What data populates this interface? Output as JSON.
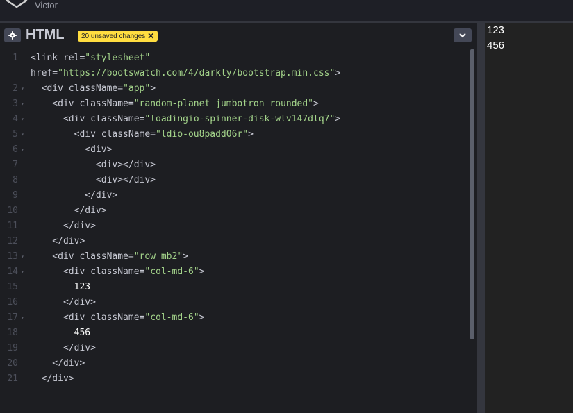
{
  "topbar": {
    "user_name": "Victor"
  },
  "editor": {
    "title": "HTML",
    "unsaved_badge": "20 unsaved changes",
    "close_symbol": "✕",
    "lines": [
      {
        "num": "1",
        "fold": "",
        "content": "<link rel=\"stylesheet\""
      },
      {
        "num": "",
        "fold": "",
        "content": "href=\"https://bootswatch.com/4/darkly/bootstrap.min.css\">"
      },
      {
        "num": "2",
        "fold": "▾",
        "content": "  <div className=\"app\">"
      },
      {
        "num": "3",
        "fold": "▾",
        "content": "    <div className=\"random-planet jumbotron rounded\">"
      },
      {
        "num": "4",
        "fold": "▾",
        "content": "      <div className=\"loadingio-spinner-disk-wlv147dlq7\">"
      },
      {
        "num": "5",
        "fold": "▾",
        "content": "        <div className=\"ldio-ou8padd06r\">"
      },
      {
        "num": "6",
        "fold": "▾",
        "content": "          <div>"
      },
      {
        "num": "7",
        "fold": "",
        "content": "            <div></div>"
      },
      {
        "num": "8",
        "fold": "",
        "content": "            <div></div>"
      },
      {
        "num": "9",
        "fold": "",
        "content": "          </div>"
      },
      {
        "num": "10",
        "fold": "",
        "content": "        </div>"
      },
      {
        "num": "11",
        "fold": "",
        "content": "      </div>"
      },
      {
        "num": "12",
        "fold": "",
        "content": "    </div>"
      },
      {
        "num": "13",
        "fold": "▾",
        "content": "    <div className=\"row mb2\">"
      },
      {
        "num": "14",
        "fold": "▾",
        "content": "      <div className=\"col-md-6\">"
      },
      {
        "num": "15",
        "fold": "",
        "content": "        123"
      },
      {
        "num": "16",
        "fold": "",
        "content": "      </div>"
      },
      {
        "num": "17",
        "fold": "▾",
        "content": "      <div className=\"col-md-6\">"
      },
      {
        "num": "18",
        "fold": "",
        "content": "        456"
      },
      {
        "num": "19",
        "fold": "",
        "content": "      </div>"
      },
      {
        "num": "20",
        "fold": "",
        "content": "    </div>"
      },
      {
        "num": "21",
        "fold": "",
        "content": "  </div>"
      }
    ]
  },
  "preview": {
    "values": [
      "123",
      "456"
    ]
  },
  "colors": {
    "accent_badge": "#ffdd40",
    "string": "#a3d38a",
    "background": "#1d1e22"
  },
  "icons": {
    "settings": "gear-icon",
    "collapse": "chevron-down-icon",
    "logo": "codepen-logo-icon"
  }
}
